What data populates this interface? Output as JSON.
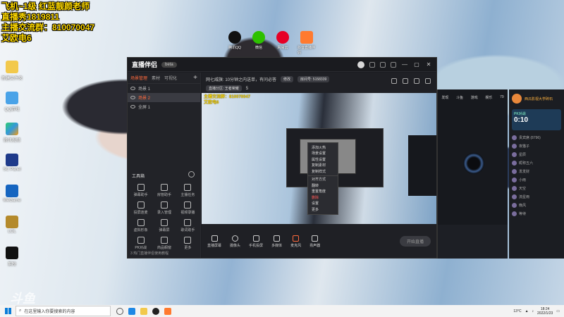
{
  "overlay": {
    "line1": "飞机~1级 红蓝靓颜老师",
    "line2": "直播秀1819811",
    "line3": "主播交流群：810070047",
    "line4": "艾欧电6"
  },
  "desktop_icons": [
    "新建文件夹",
    "QQ游戏",
    "腾讯视频",
    "SC Panel",
    "WeGame",
    "LOL",
    "剪映"
  ],
  "top_icons": [
    "腾讯QQ",
    "微信",
    "网易云",
    "抖音直播伴侣"
  ],
  "watermark": "斗鱼",
  "app": {
    "logo": "直播伴侣",
    "logo_pill": "beta",
    "left_tabs": [
      "场景管理",
      "素材",
      "可视化"
    ],
    "scenes": [
      "场景 1",
      "场景 2",
      "全屏 1"
    ],
    "tools_title": "工具箱",
    "tools": [
      "弹幕助手",
      "房管助手",
      "主播任务",
      "投屏连麦",
      "录入管理",
      "视频录播",
      "虚拟形象",
      "弹幕屏",
      "歌词助手",
      "PK对战",
      "商品橱窗",
      "更多"
    ],
    "left_footer": "3 热门直播伴侣使用教程",
    "info_line1": "网七威旗: 10分钟之内送单，有问必答",
    "info_chip1": "修改",
    "info_chip2": "房间号: 5158339",
    "info_line2": "直播分区: 王者荣耀",
    "info_count": "5",
    "preview_text1": "主播交流群：810070047",
    "preview_text2": "艾欧电6",
    "context_menu": [
      "添加火热",
      "场景设置",
      "属性设置",
      "复制素材",
      "复制样式",
      "",
      "对齐方式",
      "翻转",
      "重置角度",
      "删除",
      "设置",
      "更多"
    ],
    "footer_buttons": [
      "直播屏幕",
      "摄像头",
      "手机投屏",
      "多媒体",
      "麦克风",
      "扬声器"
    ],
    "start_button": "开始直播"
  },
  "live": {
    "top_labels": [
      "发现",
      "斗鱼",
      "游戏",
      "娱乐"
    ],
    "gold": "79"
  },
  "chat": {
    "name": "西瓜影视大学砖石",
    "pk_label": "PK对战",
    "pk_time": "0:10",
    "items": [
      "贵宾席 (8796)",
      "夜猫子",
      "星辰",
      "昵称五六",
      "发发财",
      "小雨",
      "天空",
      "流星雨",
      "晚风",
      "等待"
    ]
  },
  "taskbar": {
    "search_placeholder": "在这里输入你要搜索的内容",
    "weather": "13°C",
    "time": "18:24",
    "date": "2022/1/23"
  }
}
